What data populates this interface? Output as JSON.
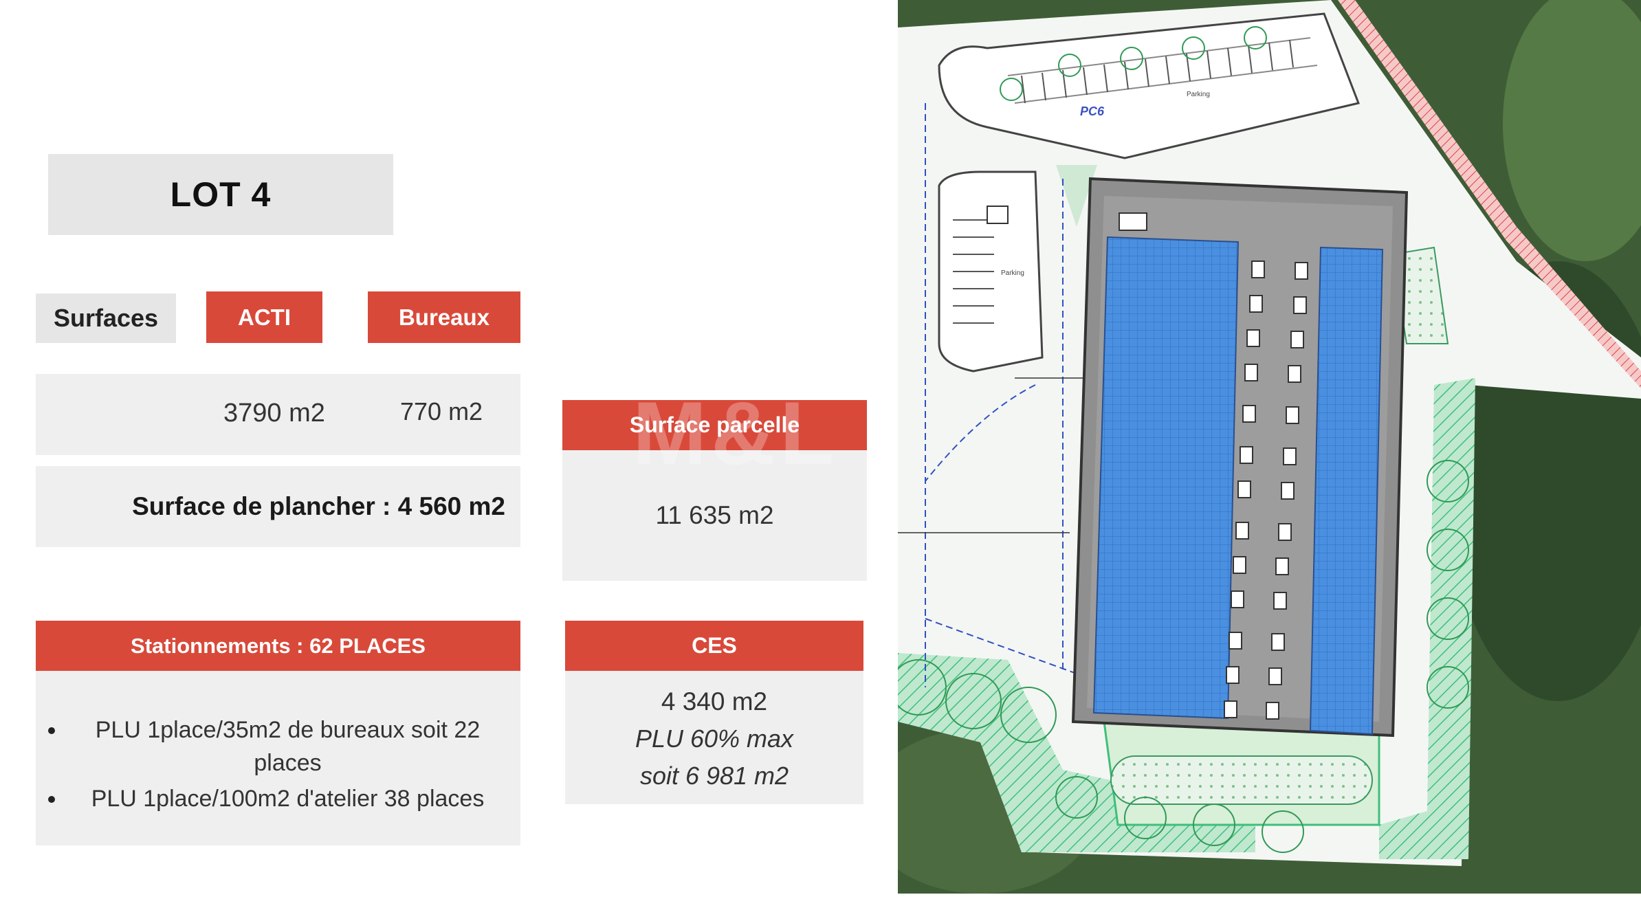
{
  "lot": {
    "title": "LOT 4"
  },
  "surfaces": {
    "label": "Surfaces",
    "acti_label": "ACTI",
    "bureaux_label": "Bureaux",
    "acti_value": "3790 m2",
    "bureaux_value": "770 m2",
    "plancher": "Surface de plancher : 4 560 m2"
  },
  "parcelle": {
    "label": "Surface parcelle",
    "value": "11 635 m2"
  },
  "stationnements": {
    "title": "Stationnements  : 62 PLACES",
    "items": [
      "PLU 1place/35m2 de bureaux soit 22 places",
      "PLU 1place/100m2 d'atelier 38 places"
    ]
  },
  "ces": {
    "label": "CES",
    "value": "4 340 m2",
    "plu": "PLU 60% max",
    "soit": "soit 6 981 m2"
  },
  "plan": {
    "labels": {
      "pc6": "PC6",
      "parking1": "Parking",
      "parking2": "Parking"
    }
  },
  "colors": {
    "accent_red": "#d9493a",
    "panel_grey": "#efefef",
    "solar_blue": "#4a8fe0",
    "green_hatch": "#3fbf7a"
  }
}
